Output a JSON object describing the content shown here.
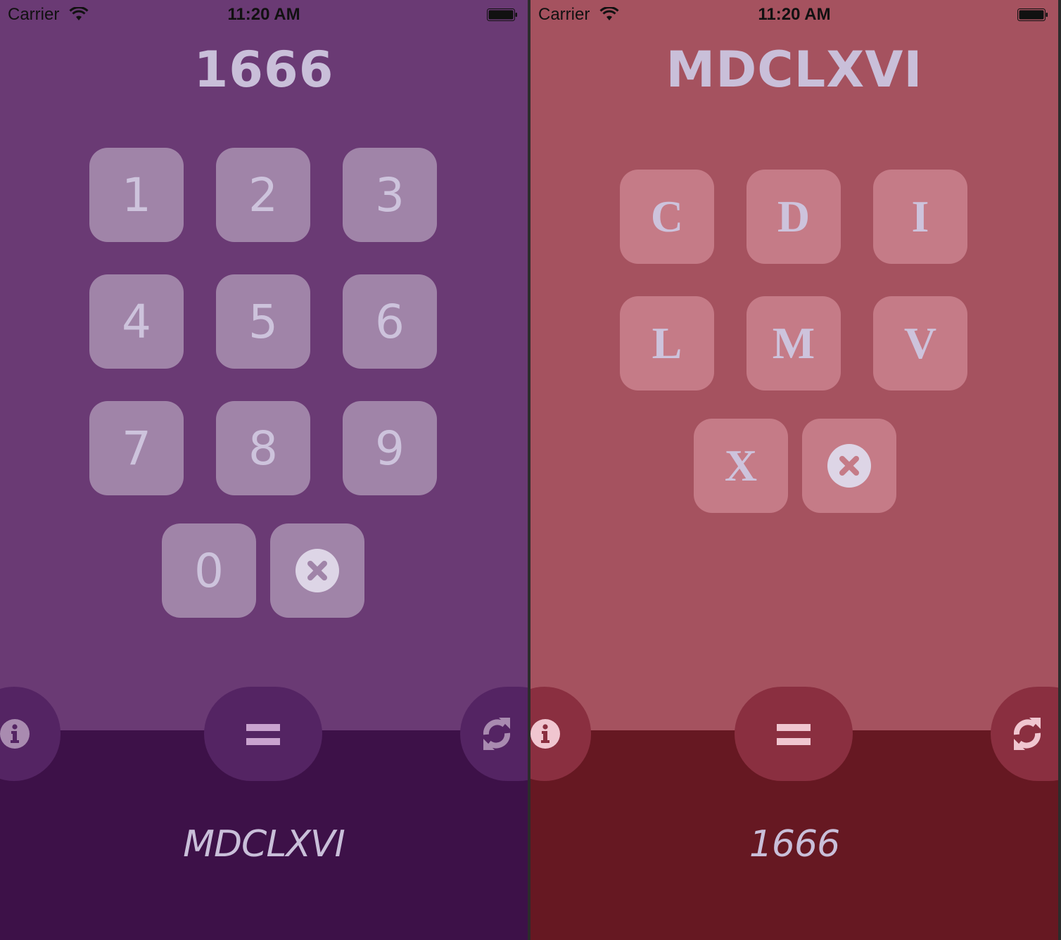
{
  "status_bar": {
    "carrier": "Carrier",
    "time": "11:20 AM",
    "wifi_icon": "wifi-icon",
    "battery_icon": "battery-icon"
  },
  "screens": [
    {
      "id": "arabic-to-roman",
      "theme": {
        "background": "#6a3a74",
        "key": "#a084a8",
        "text": "#c9bfd9",
        "lower_panel": "#3d1148",
        "round_button": "#542463",
        "equals_glyph": "#c9a3cf",
        "icon": "#a98bb0"
      },
      "display": "1666",
      "keys": [
        "1",
        "2",
        "3",
        "4",
        "5",
        "6",
        "7",
        "8",
        "9",
        "0"
      ],
      "delete_icon": "x-circle-icon",
      "info_icon": "info-icon",
      "equals_label": "=",
      "refresh_icon": "refresh-icon",
      "result": "MDCLXVI"
    },
    {
      "id": "roman-to-arabic",
      "theme": {
        "background": "#a5525f",
        "key": "#c57b87",
        "text": "#c9bfd9",
        "lower_panel": "#661822",
        "round_button": "#8a2f40",
        "equals_glyph": "#f0c6d0",
        "icon": "#f0c6d0"
      },
      "display": "MDCLXVI",
      "keys": [
        "C",
        "D",
        "I",
        "L",
        "M",
        "V",
        "X"
      ],
      "delete_icon": "x-circle-icon",
      "info_icon": "info-icon",
      "equals_label": "=",
      "refresh_icon": "refresh-icon",
      "result": "1666"
    }
  ]
}
